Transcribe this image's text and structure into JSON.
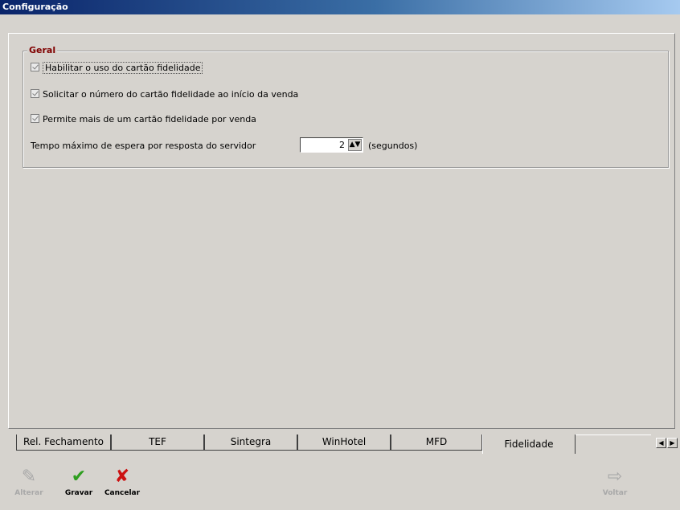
{
  "window": {
    "title": "Configuração"
  },
  "group": {
    "legend": "Geral",
    "options": [
      {
        "label": "Habilitar o uso do cartão fidelidade",
        "checked": true
      },
      {
        "label": "Solicitar o número do cartão fidelidade ao início da venda",
        "checked": true
      },
      {
        "label": "Permite mais de um cartão fidelidade por venda",
        "checked": true
      }
    ],
    "timeout": {
      "label": "Tempo máximo de espera por resposta do servidor",
      "value": "2",
      "unit": "(segundos)"
    }
  },
  "tabs": [
    {
      "label": "Rel. Fechamento"
    },
    {
      "label": "TEF"
    },
    {
      "label": "Sintegra"
    },
    {
      "label": "WinHotel"
    },
    {
      "label": "MFD"
    },
    {
      "label": "Fidelidade",
      "active": true
    }
  ],
  "toolbar": {
    "alterar": "Alterar",
    "gravar": "Gravar",
    "cancelar": "Cancelar",
    "voltar": "Voltar"
  },
  "colors": {
    "legend": "#800000",
    "gravar_icon": "#2e9e1f",
    "cancelar_icon": "#cc1111"
  }
}
